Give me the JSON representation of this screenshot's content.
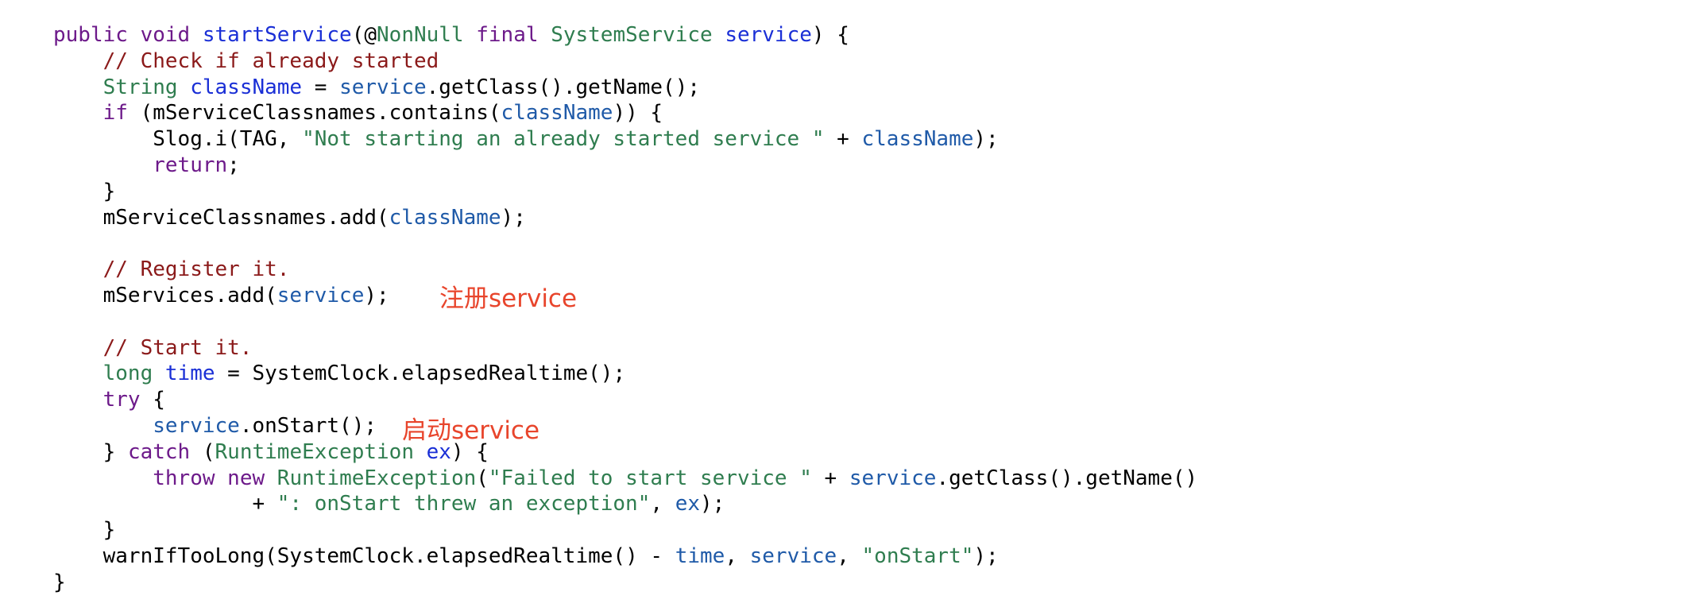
{
  "code": {
    "lines": [
      {
        "indent": "",
        "tokens": [
          {
            "t": "public",
            "k": "kw"
          },
          {
            "t": " ",
            "k": "pl"
          },
          {
            "t": "void",
            "k": "kw"
          },
          {
            "t": " ",
            "k": "pl"
          },
          {
            "t": "startService",
            "k": "fn"
          },
          {
            "t": "(",
            "k": "pl"
          },
          {
            "t": "@",
            "k": "pl"
          },
          {
            "t": "NonNull",
            "k": "an"
          },
          {
            "t": " ",
            "k": "pl"
          },
          {
            "t": "final",
            "k": "kw"
          },
          {
            "t": " ",
            "k": "pl"
          },
          {
            "t": "SystemService",
            "k": "ty"
          },
          {
            "t": " ",
            "k": "pl"
          },
          {
            "t": "service",
            "k": "pv"
          },
          {
            "t": ") {",
            "k": "pl"
          }
        ]
      },
      {
        "indent": "    ",
        "tokens": [
          {
            "t": "// Check if already started",
            "k": "cm"
          }
        ]
      },
      {
        "indent": "    ",
        "tokens": [
          {
            "t": "String",
            "k": "ty"
          },
          {
            "t": " ",
            "k": "pl"
          },
          {
            "t": "className",
            "k": "pv"
          },
          {
            "t": " = ",
            "k": "pl"
          },
          {
            "t": "service",
            "k": "lv"
          },
          {
            "t": ".getClass().getName();",
            "k": "pl"
          }
        ]
      },
      {
        "indent": "    ",
        "tokens": [
          {
            "t": "if",
            "k": "kw"
          },
          {
            "t": " (mServiceClassnames.contains(",
            "k": "pl"
          },
          {
            "t": "className",
            "k": "lv"
          },
          {
            "t": ")) {",
            "k": "pl"
          }
        ]
      },
      {
        "indent": "        ",
        "tokens": [
          {
            "t": "Slog.i(TAG, ",
            "k": "pl"
          },
          {
            "t": "\"Not starting an already started service \"",
            "k": "st"
          },
          {
            "t": " + ",
            "k": "pl"
          },
          {
            "t": "className",
            "k": "lv"
          },
          {
            "t": ");",
            "k": "pl"
          }
        ]
      },
      {
        "indent": "        ",
        "tokens": [
          {
            "t": "return",
            "k": "kw"
          },
          {
            "t": ";",
            "k": "pl"
          }
        ]
      },
      {
        "indent": "    ",
        "tokens": [
          {
            "t": "}",
            "k": "pl"
          }
        ]
      },
      {
        "indent": "    ",
        "tokens": [
          {
            "t": "mServiceClassnames.add(",
            "k": "pl"
          },
          {
            "t": "className",
            "k": "lv"
          },
          {
            "t": ");",
            "k": "pl"
          }
        ]
      },
      {
        "indent": "",
        "tokens": []
      },
      {
        "indent": "    ",
        "tokens": [
          {
            "t": "// Register it.",
            "k": "cm"
          }
        ]
      },
      {
        "indent": "    ",
        "tokens": [
          {
            "t": "mServices.add(",
            "k": "pl"
          },
          {
            "t": "service",
            "k": "lv"
          },
          {
            "t": ");",
            "k": "pl"
          }
        ]
      },
      {
        "indent": "",
        "tokens": []
      },
      {
        "indent": "    ",
        "tokens": [
          {
            "t": "// Start it.",
            "k": "cm"
          }
        ]
      },
      {
        "indent": "    ",
        "tokens": [
          {
            "t": "long",
            "k": "ty"
          },
          {
            "t": " ",
            "k": "pl"
          },
          {
            "t": "time",
            "k": "pv"
          },
          {
            "t": " = SystemClock.elapsedRealtime();",
            "k": "pl"
          }
        ]
      },
      {
        "indent": "    ",
        "tokens": [
          {
            "t": "try",
            "k": "kw"
          },
          {
            "t": " {",
            "k": "pl"
          }
        ]
      },
      {
        "indent": "        ",
        "tokens": [
          {
            "t": "service",
            "k": "lv"
          },
          {
            "t": ".onStart();",
            "k": "pl"
          }
        ]
      },
      {
        "indent": "    ",
        "tokens": [
          {
            "t": "} ",
            "k": "pl"
          },
          {
            "t": "catch",
            "k": "kw"
          },
          {
            "t": " (",
            "k": "pl"
          },
          {
            "t": "RuntimeException",
            "k": "ty"
          },
          {
            "t": " ",
            "k": "pl"
          },
          {
            "t": "ex",
            "k": "pv"
          },
          {
            "t": ") {",
            "k": "pl"
          }
        ]
      },
      {
        "indent": "        ",
        "tokens": [
          {
            "t": "throw",
            "k": "kw"
          },
          {
            "t": " ",
            "k": "pl"
          },
          {
            "t": "new",
            "k": "kw"
          },
          {
            "t": " ",
            "k": "pl"
          },
          {
            "t": "RuntimeException",
            "k": "ty"
          },
          {
            "t": "(",
            "k": "pl"
          },
          {
            "t": "\"Failed to start service \"",
            "k": "st"
          },
          {
            "t": " + ",
            "k": "pl"
          },
          {
            "t": "service",
            "k": "lv"
          },
          {
            "t": ".getClass().getName()",
            "k": "pl"
          }
        ]
      },
      {
        "indent": "                ",
        "tokens": [
          {
            "t": "+ ",
            "k": "pl"
          },
          {
            "t": "\": onStart threw an exception\"",
            "k": "st"
          },
          {
            "t": ", ",
            "k": "pl"
          },
          {
            "t": "ex",
            "k": "lv"
          },
          {
            "t": ");",
            "k": "pl"
          }
        ]
      },
      {
        "indent": "    ",
        "tokens": [
          {
            "t": "}",
            "k": "pl"
          }
        ]
      },
      {
        "indent": "    ",
        "tokens": [
          {
            "t": "warnIfTooLong(SystemClock.elapsedRealtime() - ",
            "k": "pl"
          },
          {
            "t": "time",
            "k": "lv"
          },
          {
            "t": ", ",
            "k": "pl"
          },
          {
            "t": "service",
            "k": "lv"
          },
          {
            "t": ", ",
            "k": "pl"
          },
          {
            "t": "\"onStart\"",
            "k": "st"
          },
          {
            "t": ");",
            "k": "pl"
          }
        ]
      },
      {
        "indent": "",
        "tokens": [
          {
            "t": "}",
            "k": "pl"
          }
        ]
      }
    ]
  },
  "annotations": {
    "register": "注册service",
    "start": "启动service"
  },
  "colors": {
    "keyword": "#6d1a8a",
    "type": "#2f7d4f",
    "comment": "#8b1a1a",
    "string": "#2f7d4f",
    "declaration": "#1a2fd6",
    "variable": "#1f5aa8",
    "annotation_note": "#e8452c"
  }
}
